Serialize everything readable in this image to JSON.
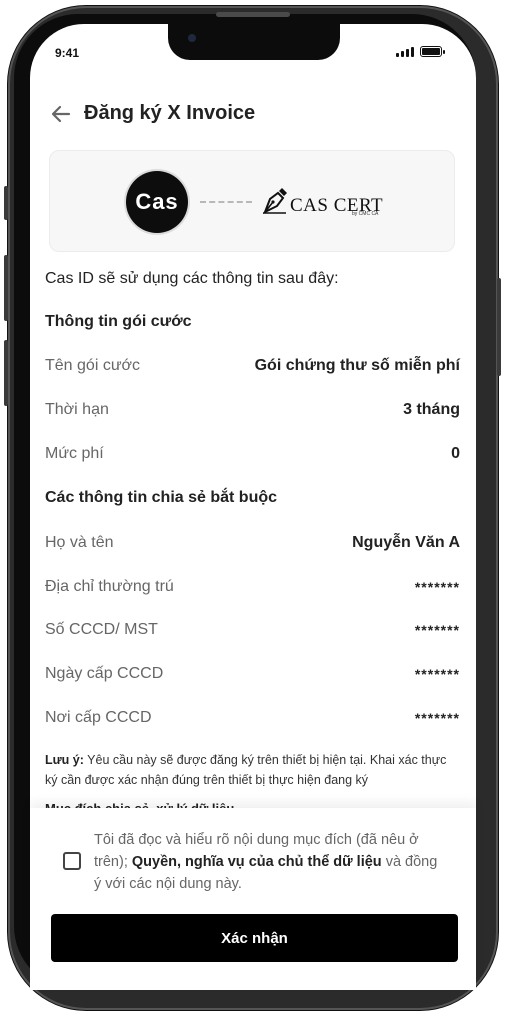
{
  "status_bar": {
    "time": "9:41"
  },
  "header": {
    "title": "Đăng ký X Invoice"
  },
  "logos": {
    "cas_text": "Cas",
    "cert_text": "CAS CERT",
    "cert_sub": "by CMC CA"
  },
  "intro": "Cas ID sẽ sử dụng các thông tin sau đây:",
  "package_section": {
    "title": "Thông tin gói cước",
    "rows": [
      {
        "label": "Tên gói cước",
        "value": "Gói chứng thư số miễn phí"
      },
      {
        "label": "Thời hạn",
        "value": "3 tháng"
      },
      {
        "label": "Mức phí",
        "value": "0"
      }
    ]
  },
  "share_section": {
    "title": "Các thông tin chia sẻ bắt buộc",
    "rows": [
      {
        "label": "Họ và tên",
        "value": "Nguyễn Văn A"
      },
      {
        "label": "Địa chỉ thường trú",
        "value": "*******"
      },
      {
        "label": "Số CCCD/ MST",
        "value": "*******"
      },
      {
        "label": "Ngày cấp CCCD",
        "value": "*******"
      },
      {
        "label": "Nơi cấp CCCD",
        "value": "*******"
      }
    ]
  },
  "note": {
    "label": "Lưu ý:",
    "text": " Yêu cầu này sẽ được đăng ký trên thiết bị hiện tại. Khai xác thực ký cần được xác nhận đúng trên thiết bị thực hiện đang ký"
  },
  "cutoff_text": "Mục đích chia sẻ, xử lý dữ liệu",
  "consent": {
    "part1": "Tôi đã đọc và hiểu rõ nội dung mục đích (đã nêu ở trên); ",
    "link": "Quyền, nghĩa vụ của chủ thể dữ liệu",
    "part2": " và đồng ý với các nội dung này."
  },
  "confirm_button": "Xác nhận"
}
